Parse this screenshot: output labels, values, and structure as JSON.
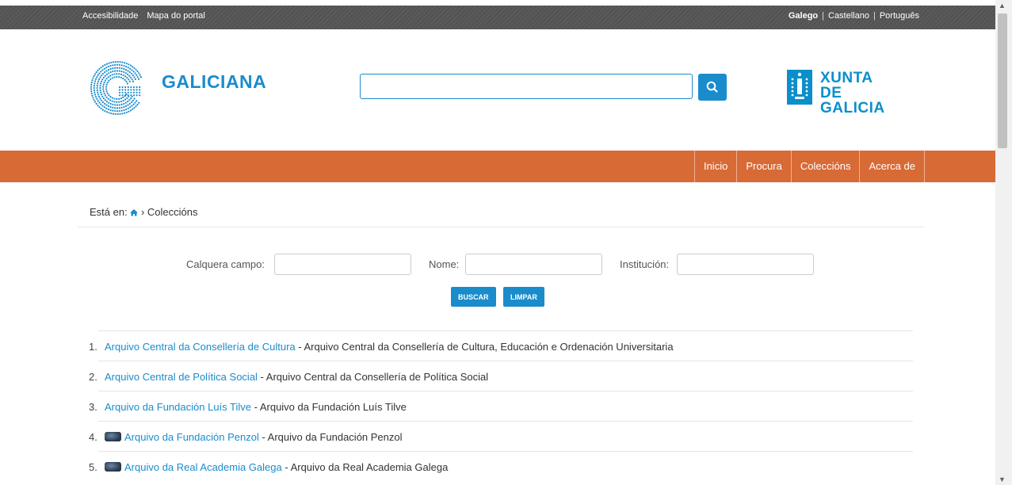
{
  "topbar": {
    "links": [
      "Accesibilidade",
      "Mapa do portal"
    ],
    "languages": [
      "Galego",
      "Castellano",
      "Português"
    ],
    "active_language": "Galego"
  },
  "header": {
    "logo_text": "GALICIANA",
    "search": {
      "value": "",
      "placeholder": ""
    },
    "partner_logo_line1": "XUNTA",
    "partner_logo_line2": "DE GALICIA"
  },
  "nav": [
    "Inicio",
    "Procura",
    "Coleccións",
    "Acerca de"
  ],
  "breadcrumb": {
    "prefix": "Está en:",
    "current": "Coleccións"
  },
  "form": {
    "any_field_label": "Calquera campo:",
    "name_label": "Nome:",
    "institution_label": "Institución:",
    "search_button": "BUSCAR",
    "clear_button": "LIMPAR"
  },
  "results": [
    {
      "n": "1.",
      "title": "Arquivo Central da Consellería de Cultura",
      "desc": " - Arquivo Central da Consellería de Cultura, Educación e Ordenación Universitaria",
      "thumb": false
    },
    {
      "n": "2.",
      "title": "Arquivo Central de Política Social",
      "desc": " - Arquivo Central da Consellería de Política Social",
      "thumb": false
    },
    {
      "n": "3.",
      "title": "Arquivo da Fundación Luís Tilve",
      "desc": " - Arquivo da Fundación Luís Tilve",
      "thumb": false
    },
    {
      "n": "4.",
      "title": "Arquivo da Fundación Penzol",
      "desc": " - Arquivo da Fundación Penzol",
      "thumb": true
    },
    {
      "n": "5.",
      "title": "Arquivo da Real Academia Galega",
      "desc": " - Arquivo da Real Academia Galega",
      "thumb": true
    }
  ],
  "colors": {
    "accent": "#1a8ccc",
    "nav": "#d86a36",
    "topbar": "#525252"
  }
}
